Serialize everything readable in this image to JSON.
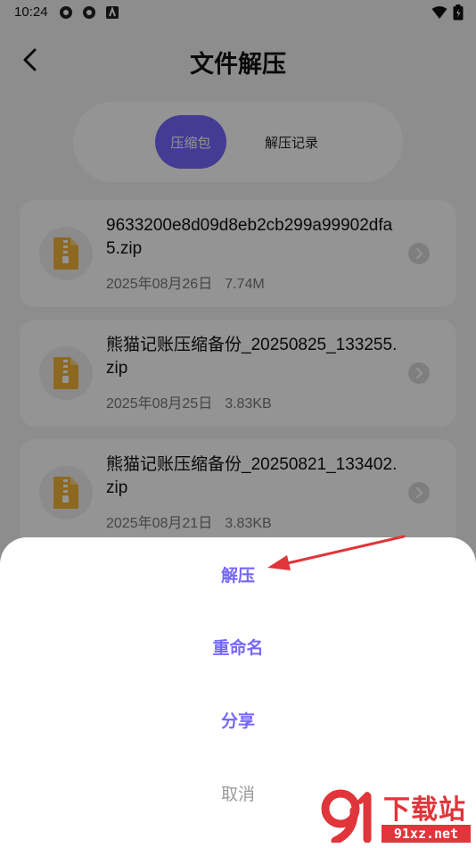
{
  "status_bar": {
    "time": "10:24"
  },
  "header": {
    "title": "文件解压"
  },
  "tabs": [
    {
      "label": "压缩包",
      "active": true
    },
    {
      "label": "解压记录",
      "active": false
    }
  ],
  "files": [
    {
      "name": "9633200e8d09d8eb2cb299a99902dfa5.zip",
      "date": "2025年08月26日",
      "size": "7.74M"
    },
    {
      "name": "熊猫记账压缩备份_20250825_133255.zip",
      "date": "2025年08月25日",
      "size": "3.83KB"
    },
    {
      "name": "熊猫记账压缩备份_20250821_133402.zip",
      "date": "2025年08月21日",
      "size": "3.83KB"
    }
  ],
  "action_sheet": {
    "extract": "解压",
    "rename": "重命名",
    "share": "分享",
    "cancel": "取消"
  },
  "watermark": {
    "title": "下载站",
    "url": "91xz.net"
  },
  "colors": {
    "accent": "#7566ff",
    "annotation": "#e0353a",
    "file_icon": "#f3b43a"
  }
}
